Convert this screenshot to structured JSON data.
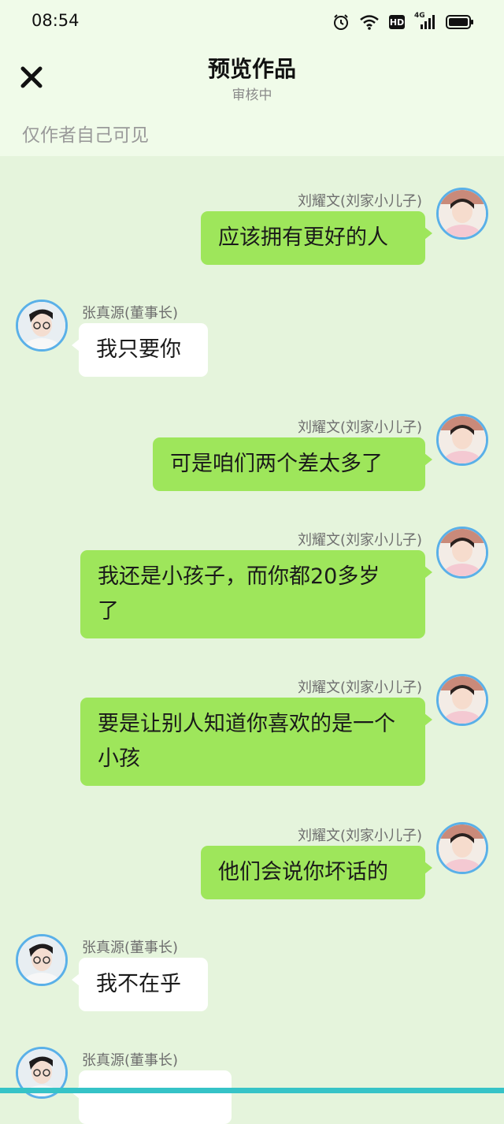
{
  "status_bar": {
    "time": "08:54",
    "network": "4G"
  },
  "header": {
    "title": "预览作品",
    "subtitle": "审核中",
    "visibility_note": "仅作者自己可见"
  },
  "messages": [
    {
      "side": "right",
      "sender": "刘耀文(刘家小儿子)",
      "text": "应该拥有更好的人"
    },
    {
      "side": "left",
      "sender": "张真源(董事长)",
      "text": "我只要你"
    },
    {
      "side": "right",
      "sender": "刘耀文(刘家小儿子)",
      "text": "可是咱们两个差太多了"
    },
    {
      "side": "right",
      "sender": "刘耀文(刘家小儿子)",
      "text": "我还是小孩子，而你都20多岁了"
    },
    {
      "side": "right",
      "sender": "刘耀文(刘家小儿子)",
      "text": "要是让别人知道你喜欢的是一个小孩"
    },
    {
      "side": "right",
      "sender": "刘耀文(刘家小儿子)",
      "text": "他们会说你坏话的"
    },
    {
      "side": "left",
      "sender": "张真源(董事长)",
      "text": "我不在乎"
    },
    {
      "side": "left",
      "sender": "张真源(董事长)",
      "text": ""
    }
  ]
}
